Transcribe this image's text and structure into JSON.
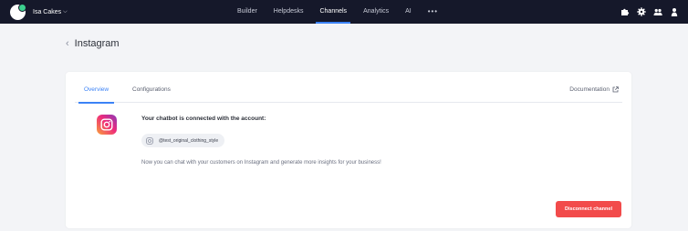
{
  "topbar": {
    "workspace_name": "Isa Cakes",
    "caret": "⌵",
    "nav": [
      {
        "label": "Builder",
        "active": false
      },
      {
        "label": "Helpdesks",
        "active": false
      },
      {
        "label": "Channels",
        "active": true
      },
      {
        "label": "Analytics",
        "active": false
      },
      {
        "label": "AI",
        "active": false
      }
    ],
    "more": "•••",
    "icons": [
      "puzzle-icon",
      "gear-icon",
      "team-icon",
      "user-icon"
    ]
  },
  "page": {
    "back": "‹",
    "title": "Instagram"
  },
  "card": {
    "tabs": [
      {
        "label": "Overview",
        "active": true
      },
      {
        "label": "Configurations",
        "active": false
      }
    ],
    "documentation_label": "Documentation",
    "connected_text": "Your chatbot is connected with the account:",
    "account_handle": "@test_original_clothing_style",
    "info_text": "Now you can chat with your customers on Instagram and generate more insights for your business!",
    "disconnect_label": "Disconnect channel"
  },
  "colors": {
    "topbar_bg": "#15182a",
    "accent": "#3b82f6",
    "danger": "#f24b4b",
    "page_bg": "#f3f4f7"
  }
}
